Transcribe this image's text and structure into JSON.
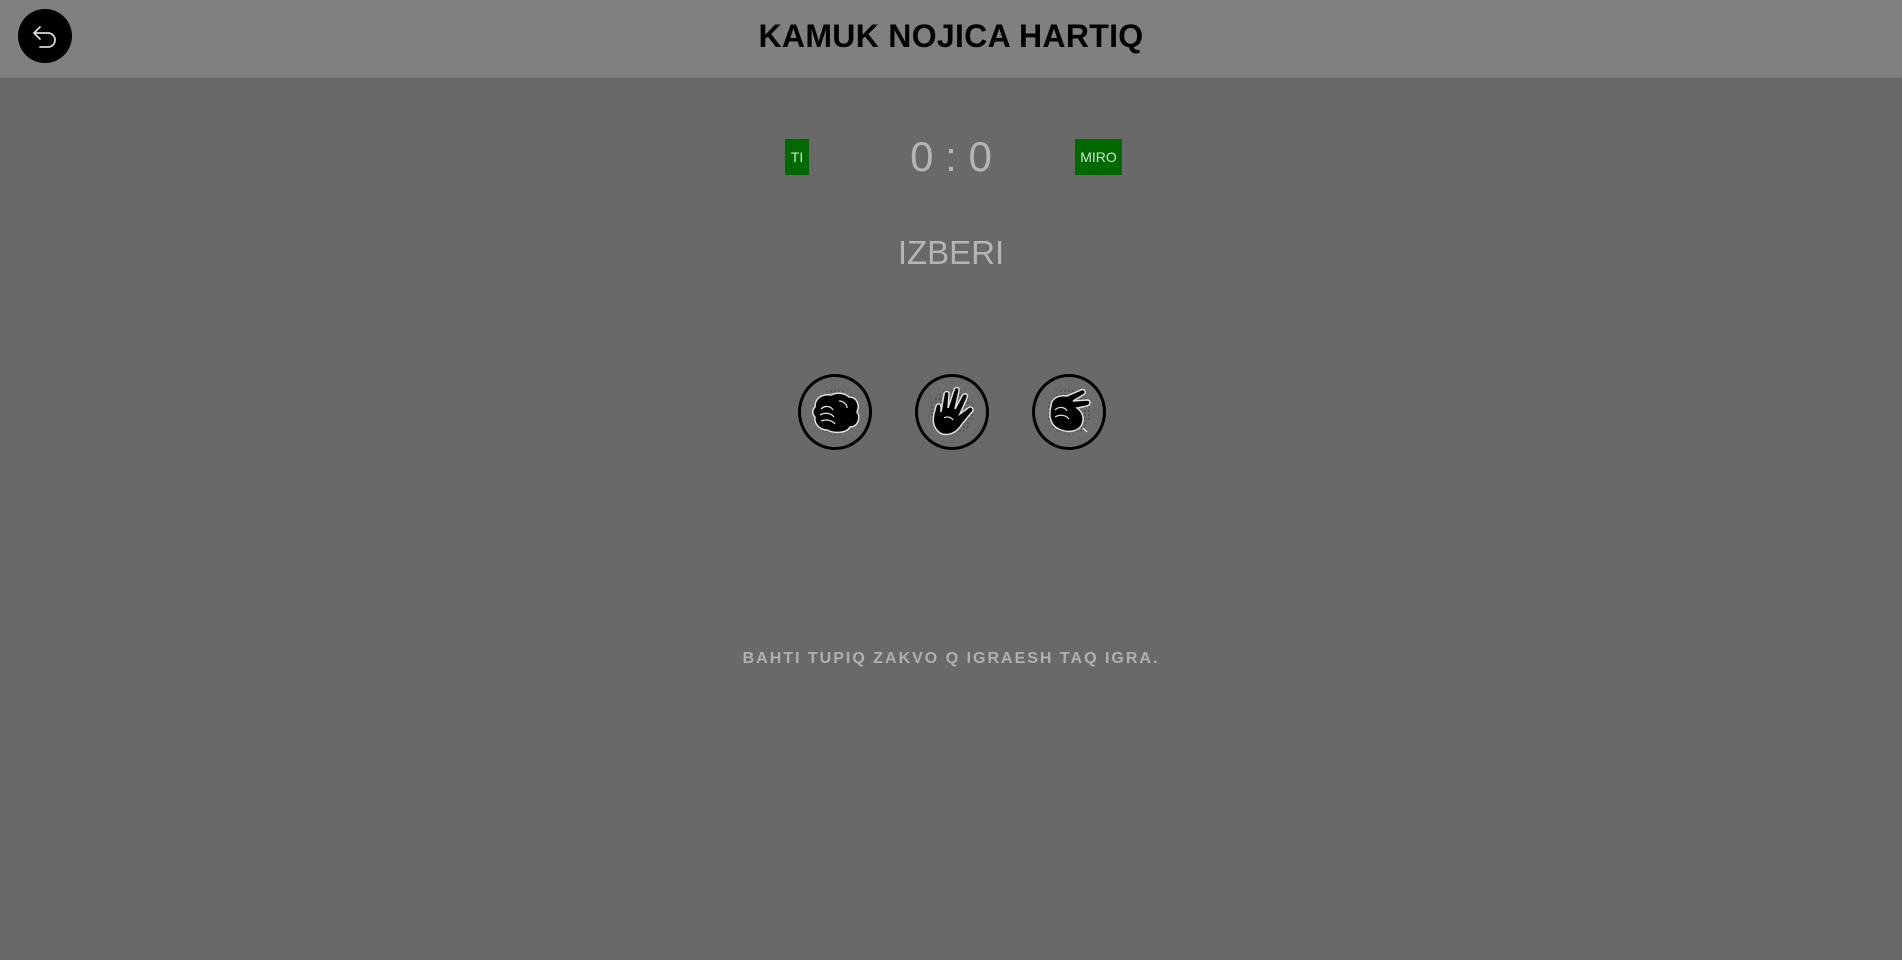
{
  "header": {
    "title": "KAMUK NOJICA HARTIQ",
    "back_icon": "undo-arrow-icon"
  },
  "scoreboard": {
    "player_label": "TI",
    "computer_label": "MIRO",
    "score": "0 : 0",
    "badge_color": "#006a00"
  },
  "game": {
    "prompt": "IZBERI",
    "choices": [
      {
        "id": "rock",
        "icon": "fist-icon"
      },
      {
        "id": "paper",
        "icon": "open-hand-icon"
      },
      {
        "id": "scissors",
        "icon": "scissors-hand-icon"
      }
    ]
  },
  "footer": {
    "message": "BAHTI TUPIQ ZAKVO Q IGRAESH TAQ IGRA."
  }
}
